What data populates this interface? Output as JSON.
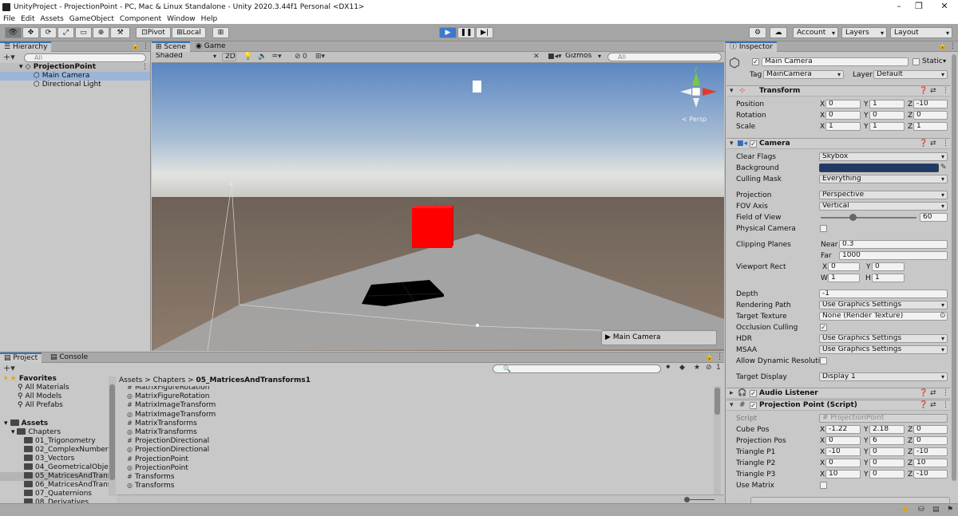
{
  "window": {
    "title": "UnityProject - ProjectionPoint - PC, Mac & Linux Standalone - Unity 2020.3.44f1 Personal <DX11>",
    "controls": [
      "–",
      "❐",
      "✕"
    ]
  },
  "menu": [
    "File",
    "Edit",
    "Assets",
    "GameObject",
    "Component",
    "Window",
    "Help"
  ],
  "toolbar": {
    "pivot": "Pivot",
    "local": "Local",
    "account": "Account",
    "layers": "Layers",
    "layout": "Layout"
  },
  "hierarchy": {
    "tab": "Hierarchy",
    "search_placeholder": "All",
    "scene": "ProjectionPoint",
    "items": [
      "Main Camera",
      "Directional Light"
    ]
  },
  "scene_view": {
    "tab_scene": "Scene",
    "tab_game": "Game",
    "shading": "Shaded",
    "mode_2d": "2D",
    "fx_count": "0",
    "gizmos": "Gizmos",
    "search_placeholder": "All",
    "persp_label": "< Persp",
    "axis_y": "y",
    "camera_preview": "Main Camera"
  },
  "project": {
    "tab_project": "Project",
    "tab_console": "Console",
    "hidden_count": "1",
    "favorites": {
      "label": "Favorites",
      "items": [
        "All Materials",
        "All Models",
        "All Prefabs"
      ]
    },
    "assets_label": "Assets",
    "chapters_label": "Chapters",
    "chapters": [
      "01_Trigonometry",
      "02_ComplexNumbers",
      "03_Vectors",
      "04_GeometricalObject",
      "05_MatricesAndTransf",
      "06_MatricesAndTransf",
      "07_Quaternions",
      "08_Derivatives"
    ],
    "breadcrumb": [
      "Assets",
      "Chapters",
      "05_MatricesAndTransforms1"
    ],
    "files": [
      {
        "icon": "#",
        "name": "MatrixFigureRotation"
      },
      {
        "icon": "◎",
        "name": "MatrixFigureRotation"
      },
      {
        "icon": "#",
        "name": "MatrixImageTransform"
      },
      {
        "icon": "◎",
        "name": "MatrixImageTransform"
      },
      {
        "icon": "#",
        "name": "MatrixTransforms"
      },
      {
        "icon": "◎",
        "name": "MatrixTransforms"
      },
      {
        "icon": "#",
        "name": "ProjectionDirectional"
      },
      {
        "icon": "◎",
        "name": "ProjectionDirectional"
      },
      {
        "icon": "#",
        "name": "ProjectionPoint"
      },
      {
        "icon": "◎",
        "name": "ProjectionPoint"
      },
      {
        "icon": "#",
        "name": "Transforms"
      },
      {
        "icon": "◎",
        "name": "Transforms"
      }
    ]
  },
  "inspector": {
    "tab": "Inspector",
    "object_name": "Main Camera",
    "static_label": "Static",
    "tag_label": "Tag",
    "tag_value": "MainCamera",
    "layer_label": "Layer",
    "layer_value": "Default",
    "transform": {
      "title": "Transform",
      "position_label": "Position",
      "position": {
        "x": "0",
        "y": "1",
        "z": "-10"
      },
      "rotation_label": "Rotation",
      "rotation": {
        "x": "0",
        "y": "0",
        "z": "0"
      },
      "scale_label": "Scale",
      "scale": {
        "x": "1",
        "y": "1",
        "z": "1"
      }
    },
    "camera": {
      "title": "Camera",
      "clear_flags_label": "Clear Flags",
      "clear_flags": "Skybox",
      "background_label": "Background",
      "background_color": "#1e3a66",
      "culling_mask_label": "Culling Mask",
      "culling_mask": "Everything",
      "projection_label": "Projection",
      "projection": "Perspective",
      "fov_axis_label": "FOV Axis",
      "fov_axis": "Vertical",
      "fov_label": "Field of View",
      "fov": "60",
      "fov_min": 1,
      "fov_max": 179,
      "fov_value": 60,
      "physical_label": "Physical Camera",
      "clipping_label": "Clipping Planes",
      "near_label": "Near",
      "near": "0.3",
      "far_label": "Far",
      "far": "1000",
      "viewport_label": "Viewport Rect",
      "vp_x": "0",
      "vp_y": "0",
      "vp_w": "1",
      "vp_h": "1",
      "depth_label": "Depth",
      "depth": "-1",
      "rendering_path_label": "Rendering Path",
      "rendering_path": "Use Graphics Settings",
      "target_texture_label": "Target Texture",
      "target_texture": "None (Render Texture)",
      "occlusion_label": "Occlusion Culling",
      "hdr_label": "HDR",
      "hdr": "Use Graphics Settings",
      "msaa_label": "MSAA",
      "msaa": "Use Graphics Settings",
      "dynamic_res_label": "Allow Dynamic Resolutio",
      "target_display_label": "Target Display",
      "target_display": "Display 1"
    },
    "audio_listener": {
      "title": "Audio Listener"
    },
    "script": {
      "title": "Projection Point (Script)",
      "script_label": "Script",
      "script_value": "ProjectionPoint",
      "cube_pos_label": "Cube Pos",
      "cube_pos": {
        "x": "-1.22",
        "y": "2.18",
        "z": "0"
      },
      "proj_pos_label": "Projection Pos",
      "proj_pos": {
        "x": "0",
        "y": "6",
        "z": "0"
      },
      "p1_label": "Triangle P1",
      "p1": {
        "x": "-10",
        "y": "0",
        "z": "-10"
      },
      "p2_label": "Triangle P2",
      "p2": {
        "x": "0",
        "y": "0",
        "z": "10"
      },
      "p3_label": "Triangle P3",
      "p3": {
        "x": "10",
        "y": "0",
        "z": "-10"
      },
      "use_matrix_label": "Use Matrix"
    }
  },
  "axis_letters": {
    "x": "X",
    "y": "Y",
    "z": "Z",
    "w": "W",
    "h": "H"
  }
}
